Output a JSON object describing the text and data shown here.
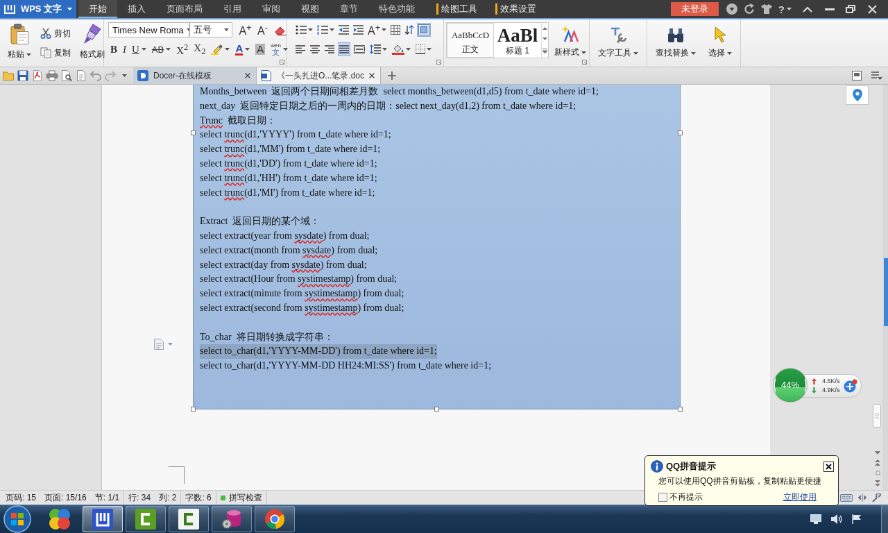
{
  "app_menu": {
    "label": "WPS 文字"
  },
  "menu_tabs": [
    {
      "label": "开始",
      "selected": true,
      "contextual": false
    },
    {
      "label": "插入",
      "selected": false,
      "contextual": false
    },
    {
      "label": "页面布局",
      "selected": false,
      "contextual": false
    },
    {
      "label": "引用",
      "selected": false,
      "contextual": false
    },
    {
      "label": "审阅",
      "selected": false,
      "contextual": false
    },
    {
      "label": "视图",
      "selected": false,
      "contextual": false
    },
    {
      "label": "章节",
      "selected": false,
      "contextual": false
    },
    {
      "label": "特色功能",
      "selected": false,
      "contextual": false
    },
    {
      "label": "绘图工具",
      "selected": false,
      "contextual": true
    },
    {
      "label": "效果设置",
      "selected": false,
      "contextual": true
    }
  ],
  "login_button": "未登录",
  "help_label": "?",
  "ribbon": {
    "clipboard": {
      "paste": "粘贴",
      "cut": "剪切",
      "copy": "复制",
      "format_painter": "格式刷"
    },
    "font": {
      "font_name": "Times New Roma",
      "font_size": "五号",
      "row1_buttons": [
        {
          "kind": "grow",
          "label": "A$^{+}$"
        },
        {
          "kind": "shrink",
          "label": "A$^{-}$"
        },
        {
          "kind": "clear"
        }
      ],
      "format_buttons": [
        {
          "kind": "bold",
          "label": "B",
          "has_menu": false
        },
        {
          "kind": "italic",
          "label": "I",
          "has_menu": false
        },
        {
          "kind": "underline",
          "label": "U",
          "has_menu": true
        },
        {
          "kind": "strike",
          "label": "AB",
          "has_menu": true
        },
        {
          "kind": "superscript",
          "label": "X$^{2}$",
          "has_menu": false
        },
        {
          "kind": "subscript",
          "label": "X$_{2}$",
          "has_menu": false
        },
        {
          "kind": "highlight",
          "has_menu": true
        },
        {
          "kind": "font-color",
          "label": "A",
          "has_menu": true
        },
        {
          "kind": "shade",
          "label": "A",
          "has_menu": false
        },
        {
          "kind": "pinyin",
          "label": "wén",
          "sub": "文",
          "has_menu": true
        }
      ]
    },
    "paragraph": {
      "row1": [
        {
          "kind": "bullets",
          "has_menu": true,
          "selected": false
        },
        {
          "kind": "numbering",
          "has_menu": true,
          "selected": false
        },
        {
          "kind": "outdent",
          "has_menu": false,
          "selected": false
        },
        {
          "kind": "indent",
          "has_menu": false,
          "selected": false
        },
        {
          "kind": "char-effect",
          "label": "A$^{+}$",
          "has_menu": true,
          "selected": false
        },
        {
          "kind": "table",
          "has_menu": false,
          "selected": false
        },
        {
          "kind": "sort",
          "has_menu": false,
          "selected": false
        },
        {
          "kind": "frame",
          "has_menu": false,
          "selected": true
        }
      ],
      "row2": [
        {
          "kind": "align-left",
          "has_menu": false,
          "selected": false
        },
        {
          "kind": "align-center",
          "has_menu": false,
          "selected": false
        },
        {
          "kind": "align-right",
          "has_menu": false,
          "selected": false
        },
        {
          "kind": "justify",
          "has_menu": false,
          "selected": true
        },
        {
          "kind": "distribute",
          "has_menu": false,
          "selected": false
        },
        {
          "kind": "line-spacing",
          "has_menu": true,
          "selected": false
        },
        {
          "kind": "shading",
          "has_menu": true,
          "selected": false
        },
        {
          "kind": "borders",
          "has_menu": true,
          "selected": false
        }
      ]
    },
    "styles": [
      {
        "kind": "body",
        "preview": "AaBbCcD",
        "name": "正文",
        "selected": true
      },
      {
        "kind": "heading",
        "preview": "AaBl",
        "name": "标题 1",
        "selected": false
      }
    ],
    "new_style": "新样式",
    "tool_groups": [
      [
        {
          "kind": "text-tools",
          "label": "文字工具",
          "has_menu": true
        }
      ],
      [
        {
          "kind": "find",
          "label": "查找替换",
          "has_menu": true
        },
        {
          "kind": "select",
          "label": "选择",
          "has_menu": true
        }
      ]
    ]
  },
  "doc_tabs": [
    {
      "kind": "docer",
      "label": "Docer-在线模板",
      "selected": false
    },
    {
      "kind": "document",
      "label": "《一头扎进O...笔录.doc",
      "selected": true
    }
  ],
  "document": {
    "sections": [
      {
        "lines": [
          {
            "highlighted": false,
            "segments": [
              {
                "text": "Months_between  返回两个日期间相差月数  select months_between(d1,d5) from t_date where id=1;",
                "misspelled": false
              }
            ]
          },
          {
            "highlighted": false,
            "segments": [
              {
                "text": "next_day  返回特定日期之后的一周内的日期：select next_day(d1,2) from t_date where id=1;",
                "misspelled": false
              }
            ]
          },
          {
            "highlighted": false,
            "segments": [
              {
                "text": "Trunc",
                "misspelled": true
              },
              {
                "text": "  截取日期：",
                "misspelled": false
              }
            ]
          },
          {
            "highlighted": false,
            "segments": [
              {
                "text": "select ",
                "misspelled": false
              },
              {
                "text": "trunc",
                "misspelled": true
              },
              {
                "text": "(d1,'YYYY') from t_date where id=1;",
                "misspelled": false
              }
            ]
          },
          {
            "highlighted": false,
            "segments": [
              {
                "text": "select ",
                "misspelled": false
              },
              {
                "text": "trunc",
                "misspelled": true
              },
              {
                "text": "(d1,'MM') from t_date where id=1;",
                "misspelled": false
              }
            ]
          },
          {
            "highlighted": false,
            "segments": [
              {
                "text": "select ",
                "misspelled": false
              },
              {
                "text": "trunc",
                "misspelled": true
              },
              {
                "text": "(d1,'DD') from t_date where id=1;",
                "misspelled": false
              }
            ]
          },
          {
            "highlighted": false,
            "segments": [
              {
                "text": "select ",
                "misspelled": false
              },
              {
                "text": "trunc",
                "misspelled": true
              },
              {
                "text": "(d1,'HH') from t_date where id=1;",
                "misspelled": false
              }
            ]
          },
          {
            "highlighted": false,
            "segments": [
              {
                "text": "select ",
                "misspelled": false
              },
              {
                "text": "trunc",
                "misspelled": true
              },
              {
                "text": "(d1,'MI') from t_date where id=1;",
                "misspelled": false
              }
            ]
          }
        ]
      },
      {
        "lines": [
          {
            "highlighted": false,
            "segments": [
              {
                "text": "Extract  返回日期的某个域：",
                "misspelled": false
              }
            ]
          },
          {
            "highlighted": false,
            "segments": [
              {
                "text": "select extract(year from ",
                "misspelled": false
              },
              {
                "text": "sysdate",
                "misspelled": true
              },
              {
                "text": ") from dual;",
                "misspelled": false
              }
            ]
          },
          {
            "highlighted": false,
            "segments": [
              {
                "text": "select extract(month from ",
                "misspelled": false
              },
              {
                "text": "sysdate",
                "misspelled": true
              },
              {
                "text": ") from dual;",
                "misspelled": false
              }
            ]
          },
          {
            "highlighted": false,
            "segments": [
              {
                "text": "select extract(day from ",
                "misspelled": false
              },
              {
                "text": "sysdate",
                "misspelled": true
              },
              {
                "text": ") from dual;",
                "misspelled": false
              }
            ]
          },
          {
            "highlighted": false,
            "segments": [
              {
                "text": "select extract(Hour from ",
                "misspelled": false
              },
              {
                "text": "systimestamp",
                "misspelled": true
              },
              {
                "text": ") from dual;",
                "misspelled": false
              }
            ]
          },
          {
            "highlighted": false,
            "segments": [
              {
                "text": "select extract(minute from ",
                "misspelled": false
              },
              {
                "text": "systimestamp",
                "misspelled": true
              },
              {
                "text": ") from dual;",
                "misspelled": false
              }
            ]
          },
          {
            "highlighted": false,
            "segments": [
              {
                "text": "select extract(second from ",
                "misspelled": false
              },
              {
                "text": "systimestamp",
                "misspelled": true
              },
              {
                "text": ") from dual;",
                "misspelled": false
              }
            ]
          }
        ]
      },
      {
        "lines": [
          {
            "highlighted": false,
            "segments": [
              {
                "text": "To_char  将日期转换成字符串：",
                "misspelled": false
              }
            ]
          },
          {
            "highlighted": true,
            "segments": [
              {
                "text": "select to_char(d1,'YYYY-MM-DD') from t_date where id=1;",
                "misspelled": false
              }
            ]
          },
          {
            "highlighted": false,
            "segments": [
              {
                "text": "select to_char(d1,'YYYY-MM-DD HH24:MI:SS') from t_date where id=1;",
                "misspelled": false
              }
            ]
          }
        ]
      }
    ]
  },
  "net_widget": {
    "memory": "44%",
    "level": 0.44,
    "upload": "4.6K/s",
    "download": "4.9K/s"
  },
  "status_bar": {
    "groups": [
      [
        "页码: 15",
        "页面: 15/16",
        "节: 1/1"
      ],
      [
        "行: 34",
        "列: 2"
      ],
      [
        "字数: 6"
      ]
    ],
    "spell_check": {
      "label": "拼写检查",
      "on": true
    }
  },
  "taskbar": {
    "apps": [
      {
        "kind": "circles",
        "running": false,
        "active": false
      },
      {
        "kind": "writer",
        "running": true,
        "active": true
      },
      {
        "kind": "recorder",
        "running": true,
        "active": false
      },
      {
        "kind": "editor",
        "running": true,
        "active": false
      },
      {
        "kind": "database",
        "running": true,
        "active": false
      },
      {
        "kind": "browser",
        "running": true,
        "active": false
      }
    ]
  },
  "qq_tip": {
    "title": "QQ拼音提示",
    "message": "您可以使用QQ拼音剪贴板，复制粘贴更便捷",
    "dont_show": {
      "label": "不再提示",
      "checked": false
    },
    "link": "立即使用"
  }
}
